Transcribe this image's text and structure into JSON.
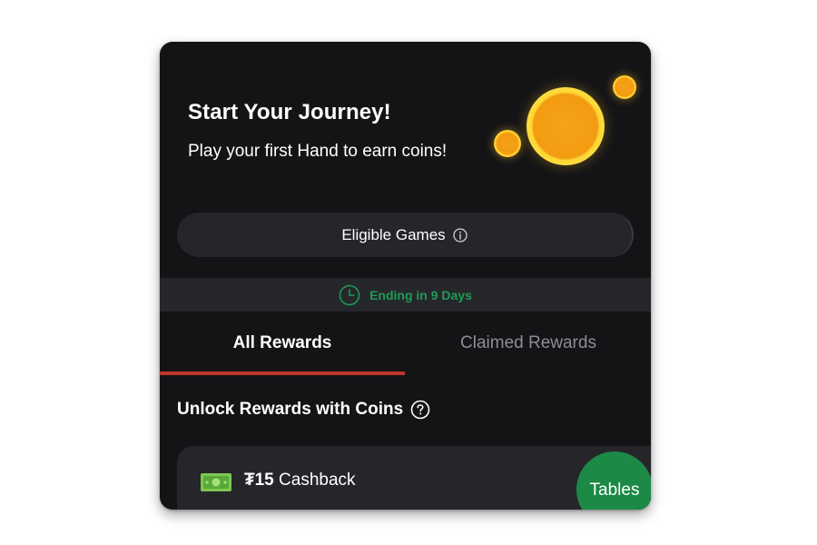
{
  "hero": {
    "title": "Start Your Journey!",
    "subtitle": "Play your first Hand to earn coins!"
  },
  "eligible_games": {
    "label": "Eligible Games",
    "icon": "info-icon"
  },
  "timer": {
    "text": "Ending in 9 Days",
    "icon": "clock-icon"
  },
  "tabs": [
    {
      "label": "All Rewards",
      "active": true
    },
    {
      "label": "Claimed Rewards",
      "active": false
    }
  ],
  "section": {
    "title": "Unlock Rewards with Coins",
    "icon": "help-icon"
  },
  "rewards": [
    {
      "amount": "₮15",
      "label": "Cashback",
      "icon": "cash-icon"
    }
  ],
  "tables_button": {
    "label": "Tables"
  },
  "colors": {
    "background": "#141417",
    "surface": "#25252a",
    "timer_green": "#1f9a57",
    "tab_indicator": "#c0352b",
    "tables_green": "#1c8a46",
    "coin_gold": "#f39c12"
  }
}
